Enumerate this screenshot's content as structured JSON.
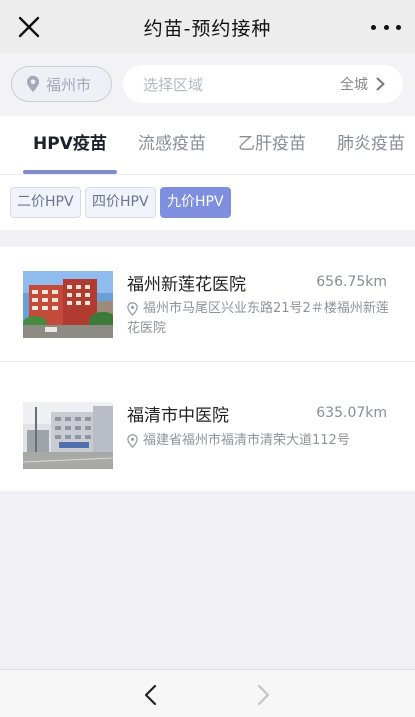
{
  "titlebar": {
    "title": "约苗-预约接种",
    "close_icon": "close-icon",
    "more_icon": "more-dots-icon"
  },
  "location": {
    "city": "福州市",
    "region_placeholder": "选择区域",
    "region_scope": "全城"
  },
  "tabs": [
    {
      "label": "HPV疫苗",
      "active": true
    },
    {
      "label": "流感疫苗",
      "active": false
    },
    {
      "label": "乙肝疫苗",
      "active": false
    },
    {
      "label": "肺炎疫苗",
      "active": false
    }
  ],
  "subfilters": [
    {
      "label": "二价HPV",
      "active": false
    },
    {
      "label": "四价HPV",
      "active": false
    },
    {
      "label": "九价HPV",
      "active": true
    }
  ],
  "hospitals": [
    {
      "name": "福州新莲花医院",
      "distance": "656.75km",
      "address": "福州市马尾区兴业东路21号2＃楼福州新莲花医院"
    },
    {
      "name": "福清市中医院",
      "distance": "635.07km",
      "address": "福建省福州市福清市清荣大道112号"
    }
  ],
  "bottom_nav": {
    "back_icon": "chevron-left-icon",
    "forward_icon": "chevron-right-icon"
  },
  "colors": {
    "accent": "#7e8fe0",
    "tab_underline": "#7f8ec8",
    "background": "#f1f1f4"
  }
}
